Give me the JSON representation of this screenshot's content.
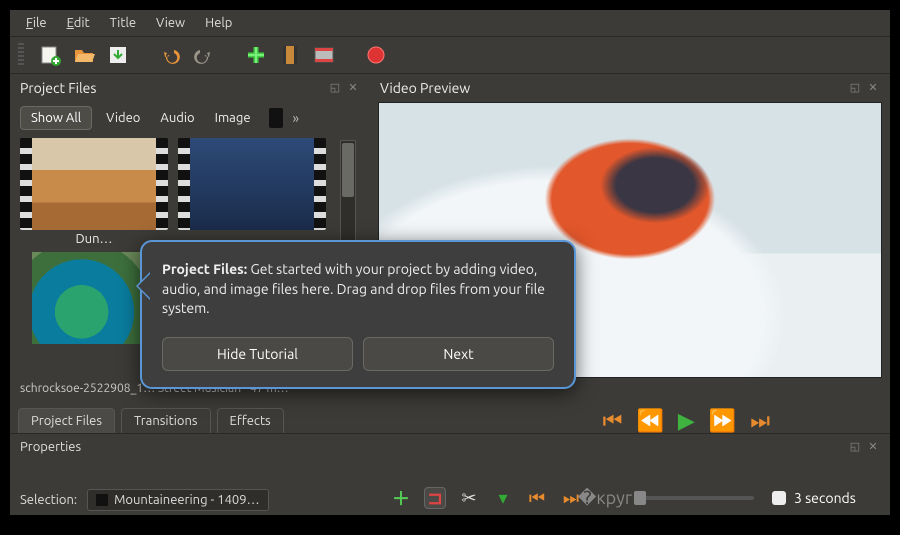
{
  "menu": {
    "file": "File",
    "edit": "Edit",
    "title": "Title",
    "view": "View",
    "help": "Help"
  },
  "panels": {
    "project": "Project Files",
    "preview": "Video Preview",
    "properties": "Properties"
  },
  "filters": {
    "show_all": "Show All",
    "video": "Video",
    "audio": "Audio",
    "image": "Image",
    "more": "»"
  },
  "thumbs": {
    "dune": "Dun…",
    "cut_row": "schrocksoe-2522908_1…   Street Musician - 47 m…"
  },
  "tutorial": {
    "title": "Project Files:",
    "body": " Get started with your project by adding video, audio, and image files here. Drag and drop files from your file system.",
    "hide": "Hide Tutorial",
    "next": "Next"
  },
  "tabs": {
    "project": "Project Files",
    "transitions": "Transitions",
    "effects": "Effects"
  },
  "selection": {
    "label": "Selection:",
    "value": "Mountaineering - 1409…"
  },
  "timeline": {
    "seconds": "3 seconds"
  }
}
